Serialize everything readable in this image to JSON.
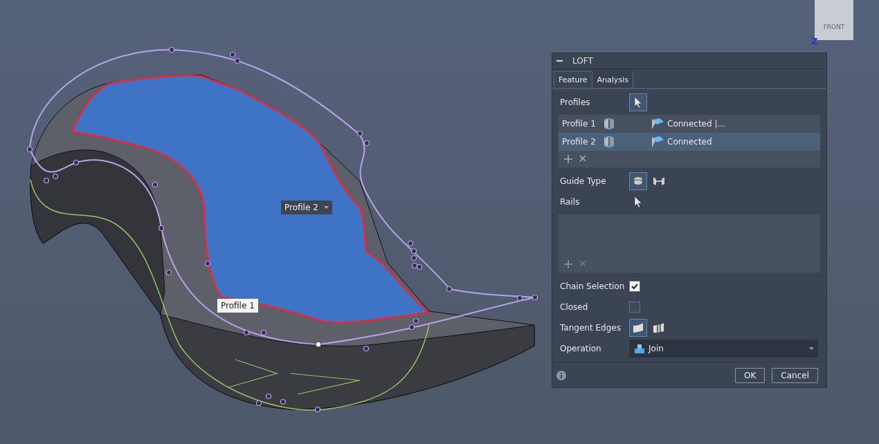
{
  "viewport": {
    "labels": [
      {
        "text": "Profile 2",
        "kind": "dropdown"
      },
      {
        "text": "Profile 1",
        "kind": "plain"
      }
    ],
    "view_cube": {
      "face": "FRONT",
      "axis": "Z"
    }
  },
  "panel": {
    "title": "LOFT",
    "tabs": [
      {
        "label": "Feature",
        "selected": true
      },
      {
        "label": "Analysis",
        "selected": false
      }
    ],
    "profiles": {
      "label": "Profiles",
      "rows": [
        {
          "name": "Profile 1",
          "condition": "Connected |...",
          "selected": false
        },
        {
          "name": "Profile 2",
          "condition": "Connected",
          "selected": true
        }
      ]
    },
    "guide_type": {
      "label": "Guide Type",
      "options": [
        {
          "kind": "rails",
          "selected": true
        },
        {
          "kind": "centerline",
          "selected": false
        }
      ]
    },
    "rails": {
      "label": "Rails"
    },
    "chain_selection": {
      "label": "Chain Selection",
      "checked": true
    },
    "closed": {
      "label": "Closed",
      "checked": false
    },
    "tangent_edges": {
      "label": "Tangent Edges",
      "options": [
        {
          "kind": "merge",
          "selected": true
        },
        {
          "kind": "keep",
          "selected": false
        }
      ]
    },
    "operation": {
      "label": "Operation",
      "value": "Join"
    },
    "buttons": [
      "OK",
      "Cancel"
    ]
  }
}
